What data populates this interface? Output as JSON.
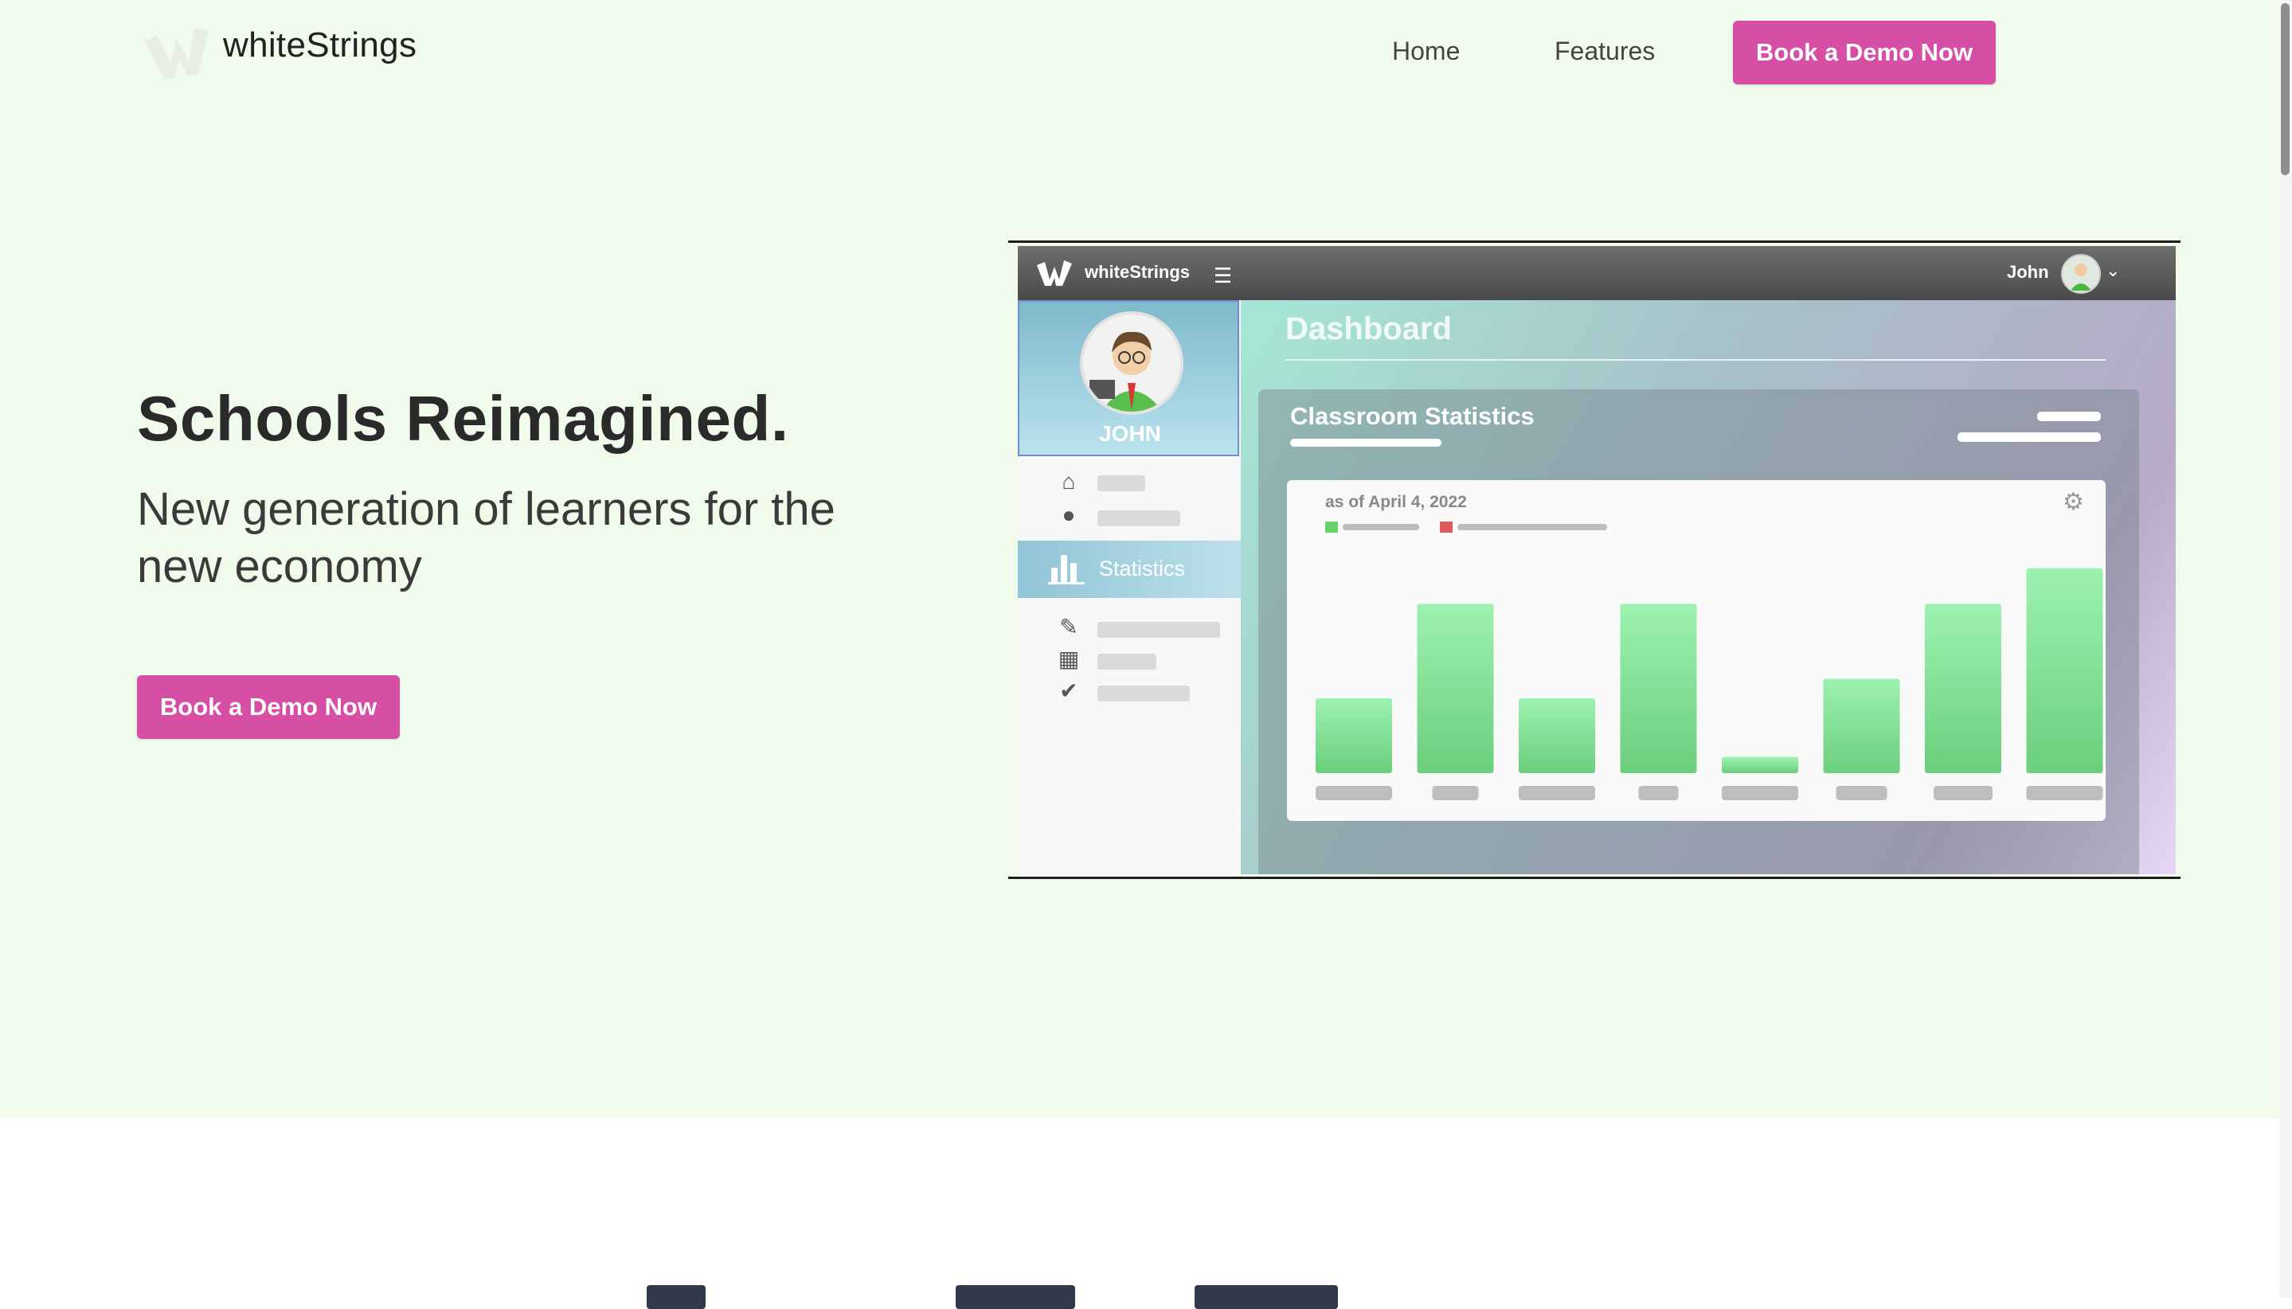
{
  "nav": {
    "brand": "whiteStrings",
    "links": [
      "Home",
      "Features"
    ],
    "cta": "Book a Demo Now"
  },
  "hero": {
    "headline": "Schools Reimagined.",
    "subheadline": "New generation of learners for the new economy",
    "cta": "Book a Demo Now"
  },
  "mockup": {
    "brand": "whiteStrings",
    "user": "John",
    "profile_name": "JOHN",
    "active_item": "Statistics",
    "page_title": "Dashboard",
    "card_title": "Classroom Statistics",
    "as_of": "as of April 4, 2022",
    "icons": [
      "hamburger-icon",
      "home-icon",
      "user-circle-icon",
      "statistics-icon",
      "pencil-icon",
      "calendar-icon",
      "check-circle-icon",
      "gear-icon",
      "chevron-down-icon"
    ],
    "colors": {
      "bar_top": "#9cf2b0",
      "bar_bottom": "#6bcf7c",
      "legend_green": "#67d36a",
      "legend_red": "#e05b5b"
    }
  },
  "chart_data": {
    "type": "bar",
    "values": [
      23,
      52,
      23,
      52,
      5,
      29,
      52,
      63
    ],
    "ylim": [
      0,
      70
    ],
    "categories": [
      "",
      "",
      "",
      "",
      "",
      "",
      "",
      ""
    ],
    "legend": "top-left"
  },
  "colors": {
    "brand_pink": "#d64fa5",
    "hero_bg": "#f0fbec"
  }
}
